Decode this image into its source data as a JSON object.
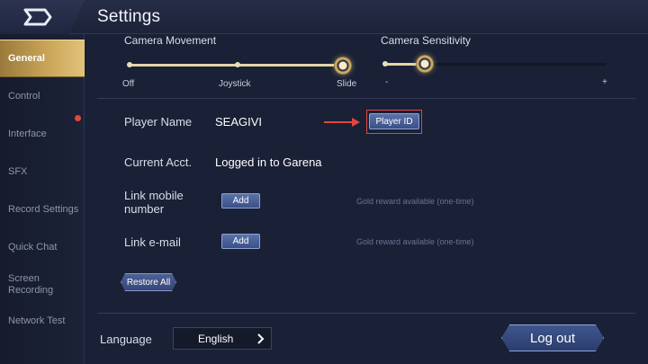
{
  "header": {
    "title": "Settings"
  },
  "sidebar": {
    "items": [
      {
        "label": "General",
        "active": true
      },
      {
        "label": "Control"
      },
      {
        "label": "Interface",
        "notification": true
      },
      {
        "label": "SFX"
      },
      {
        "label": "Record Settings"
      },
      {
        "label": "Quick Chat"
      },
      {
        "label": "Screen Recording"
      },
      {
        "label": "Network Test"
      }
    ]
  },
  "camera_movement": {
    "label": "Camera Movement",
    "options": [
      "Off",
      "Joystick",
      "Slide"
    ],
    "selected": "Slide"
  },
  "camera_sensitivity": {
    "label": "Camera Sensitivity",
    "min_label": "-",
    "max_label": "+",
    "level": 0.18
  },
  "player_name": {
    "label": "Player Name",
    "value": "SEAGIVI",
    "button": "Player ID"
  },
  "current_account": {
    "label": "Current Acct.",
    "value": "Logged in to Garena"
  },
  "link_mobile": {
    "label": "Link mobile number",
    "button": "Add",
    "hint": "Gold reward available (one-time)"
  },
  "link_email": {
    "label": "Link e-mail",
    "button": "Add",
    "hint": "Gold reward available (one-time)"
  },
  "restore_all": "Restore All",
  "language": {
    "label": "Language",
    "value": "English"
  },
  "logout": "Log out",
  "colors": {
    "accent_gold": "#c9a458",
    "highlight_red": "#e2473f",
    "button_blue": "#3b5088"
  },
  "icons": [
    "back-icon",
    "chevron-right-icon",
    "arrow-right-icon"
  ]
}
